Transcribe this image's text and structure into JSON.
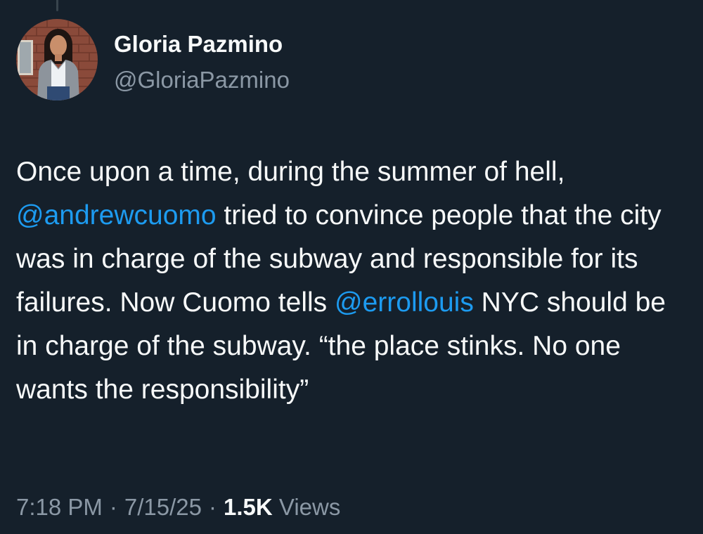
{
  "author": {
    "display_name": "Gloria Pazmino",
    "handle": "@GloriaPazmino"
  },
  "tweet": {
    "segments": [
      {
        "type": "text",
        "text": "Once upon a time, during the summer of hell, "
      },
      {
        "type": "mention",
        "text": "@andrewcuomo"
      },
      {
        "type": "text",
        "text": " tried to convince people that the city was in charge of the subway and responsible for its failures. Now Cuomo tells "
      },
      {
        "type": "mention",
        "text": "@errollouis"
      },
      {
        "type": "text",
        "text": " NYC should be in charge of the subway. “the place stinks. No one wants the responsibility”"
      }
    ]
  },
  "meta": {
    "time": "7:18 PM",
    "separator": "·",
    "date": "7/15/25",
    "views_count": "1.5K",
    "views_label": "Views"
  },
  "colors": {
    "background": "#15202b",
    "text_primary": "#f7f9f9",
    "text_secondary": "#8b98a5",
    "link": "#1d9bf0"
  }
}
